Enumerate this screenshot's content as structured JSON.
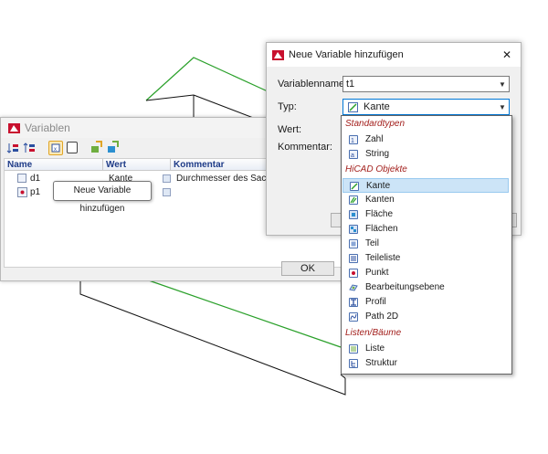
{
  "variables_window": {
    "title": "Variablen",
    "columns": [
      "Name",
      "Wert",
      "Kommentar"
    ],
    "rows": [
      {
        "name": "d1",
        "value": "Kante",
        "comment": "Durchmesser des Sacklochs"
      },
      {
        "name": "p1",
        "value": "",
        "comment": ""
      }
    ],
    "tooltip": "Neue Variable hinzufügen",
    "ok_label": "OK"
  },
  "dialog": {
    "title": "Neue Variable hinzufügen",
    "close_symbol": "✕",
    "name_label": "Variablenname:",
    "name_value": "t1",
    "type_label": "Typ:",
    "type_value": "Kante",
    "value_label": "Wert:",
    "comment_label": "Kommentar:"
  },
  "dropdown": {
    "groups": [
      {
        "label": "Standardtypen",
        "items": [
          {
            "label": "Zahl",
            "icon": "number-icon"
          },
          {
            "label": "String",
            "icon": "string-icon"
          }
        ]
      },
      {
        "label": "HiCAD Objekte",
        "items": [
          {
            "label": "Kante",
            "icon": "edge-icon",
            "selected": true
          },
          {
            "label": "Kanten",
            "icon": "edges-icon"
          },
          {
            "label": "Fläche",
            "icon": "face-icon"
          },
          {
            "label": "Flächen",
            "icon": "faces-icon"
          },
          {
            "label": "Teil",
            "icon": "part-icon"
          },
          {
            "label": "Teileliste",
            "icon": "partlist-icon"
          },
          {
            "label": "Punkt",
            "icon": "point-icon"
          },
          {
            "label": "Bearbeitungsebene",
            "icon": "plane-icon"
          },
          {
            "label": "Profil",
            "icon": "profile-icon"
          },
          {
            "label": "Path 2D",
            "icon": "path-icon"
          }
        ]
      },
      {
        "label": "Listen/Bäume",
        "items": [
          {
            "label": "Liste",
            "icon": "list-icon"
          },
          {
            "label": "Struktur",
            "icon": "tree-icon"
          }
        ]
      }
    ]
  },
  "colors": {
    "category": "#a3201d",
    "header_text": "#1f3c88",
    "selection": "#cce4f7",
    "cad_green": "#2aa02a"
  }
}
